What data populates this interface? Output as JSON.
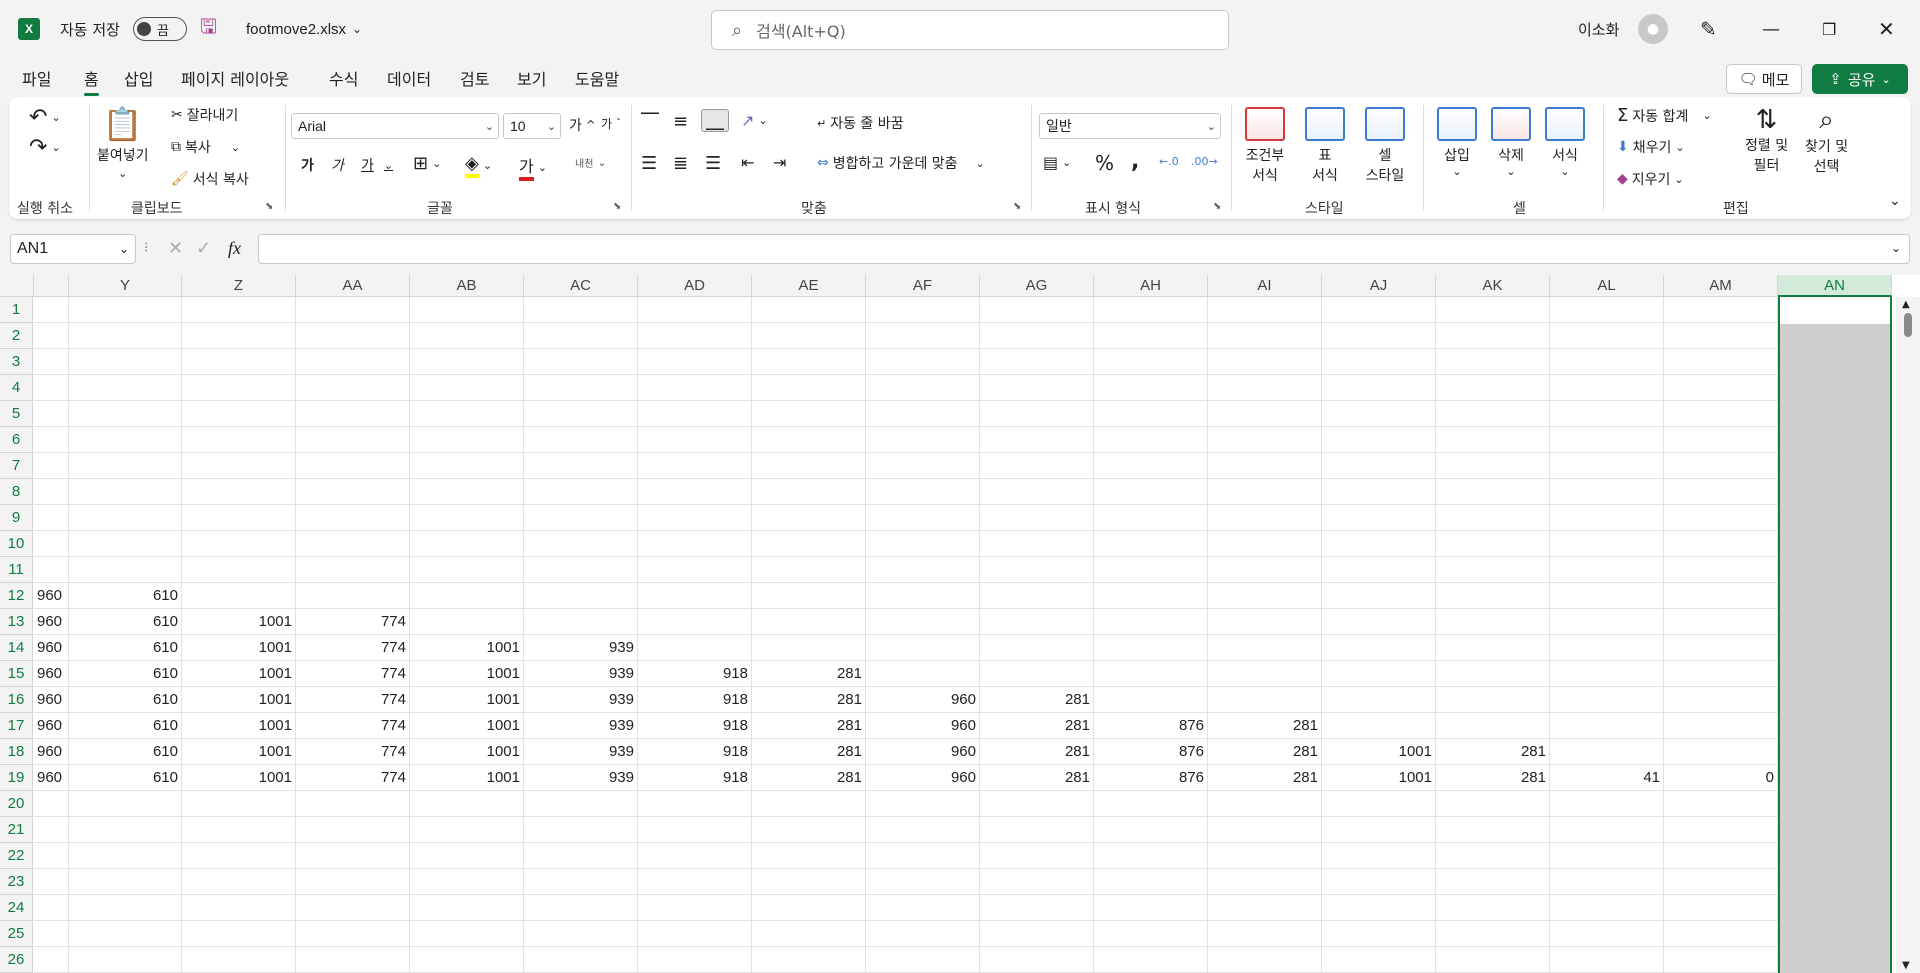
{
  "titlebar": {
    "autosave_label": "자동 저장",
    "autosave_state": "끔",
    "filename": "footmove2.xlsx",
    "search_placeholder": "검색(Alt+Q)",
    "user_name": "이소화"
  },
  "menu": {
    "items": [
      "파일",
      "홈",
      "삽입",
      "페이지 레이아웃",
      "수식",
      "데이터",
      "검토",
      "보기",
      "도움말"
    ],
    "active": "홈",
    "memo_label": "메모",
    "share_label": "공유"
  },
  "ribbon": {
    "undo_group": "실행 취소",
    "clipboard": {
      "label": "클립보드",
      "paste": "붙여넣기",
      "cut": "잘라내기",
      "copy": "복사",
      "format_painter": "서식 복사"
    },
    "font": {
      "label": "글꼴",
      "name": "Arial",
      "size": "10",
      "bold": "가",
      "italic": "가",
      "underline": "가",
      "font_color_letter": "가",
      "phonetic": "내천"
    },
    "alignment": {
      "label": "맞춤",
      "wrap": "자동 줄 바꿈",
      "merge": "병합하고 가운데 맞춤"
    },
    "number": {
      "label": "표시 형식",
      "format": "일반",
      "percent": "%",
      "comma": ","
    },
    "styles": {
      "label": "스타일",
      "conditional": [
        "조건부",
        "서식"
      ],
      "table": [
        "표",
        "서식"
      ],
      "cell": [
        "셀",
        "스타일"
      ]
    },
    "cells": {
      "label": "셀",
      "insert": "삽입",
      "delete": "삭제",
      "format": "서식"
    },
    "editing": {
      "label": "편집",
      "autosum": "자동 합계",
      "fill": "채우기",
      "clear": "지우기",
      "sort": [
        "정렬 및",
        "필터"
      ],
      "find": [
        "찾기 및",
        "선택"
      ]
    }
  },
  "formula_bar": {
    "name_box": "AN1",
    "fx": "fx",
    "content": ""
  },
  "sheet": {
    "columns": [
      "Y",
      "Z",
      "AA",
      "AB",
      "AC",
      "AD",
      "AE",
      "AF",
      "AG",
      "AH",
      "AI",
      "AJ",
      "AK",
      "AL",
      "AM",
      "AN"
    ],
    "selected_column": "AN",
    "rows": [
      {
        "n": "1",
        "c": []
      },
      {
        "n": "2",
        "c": []
      },
      {
        "n": "3",
        "c": []
      },
      {
        "n": "4",
        "c": []
      },
      {
        "n": "5",
        "c": []
      },
      {
        "n": "6",
        "c": []
      },
      {
        "n": "7",
        "c": []
      },
      {
        "n": "8",
        "c": []
      },
      {
        "n": "9",
        "c": []
      },
      {
        "n": "10",
        "c": []
      },
      {
        "n": "11",
        "c": []
      },
      {
        "n": "12",
        "c": [
          "960",
          "610"
        ]
      },
      {
        "n": "13",
        "c": [
          "960",
          "610",
          "1001",
          "774"
        ]
      },
      {
        "n": "14",
        "c": [
          "960",
          "610",
          "1001",
          "774",
          "1001",
          "939"
        ]
      },
      {
        "n": "15",
        "c": [
          "960",
          "610",
          "1001",
          "774",
          "1001",
          "939",
          "918",
          "281"
        ]
      },
      {
        "n": "16",
        "c": [
          "960",
          "610",
          "1001",
          "774",
          "1001",
          "939",
          "918",
          "281",
          "960",
          "281"
        ]
      },
      {
        "n": "17",
        "c": [
          "960",
          "610",
          "1001",
          "774",
          "1001",
          "939",
          "918",
          "281",
          "960",
          "281",
          "876",
          "281"
        ]
      },
      {
        "n": "18",
        "c": [
          "960",
          "610",
          "1001",
          "774",
          "1001",
          "939",
          "918",
          "281",
          "960",
          "281",
          "876",
          "281",
          "1001",
          "281"
        ]
      },
      {
        "n": "19",
        "c": [
          "960",
          "610",
          "1001",
          "774",
          "1001",
          "939",
          "918",
          "281",
          "960",
          "281",
          "876",
          "281",
          "1001",
          "281",
          "41",
          "0"
        ]
      },
      {
        "n": "20",
        "c": []
      },
      {
        "n": "21",
        "c": []
      },
      {
        "n": "22",
        "c": []
      },
      {
        "n": "23",
        "c": []
      },
      {
        "n": "24",
        "c": []
      },
      {
        "n": "25",
        "c": []
      },
      {
        "n": "26",
        "c": []
      }
    ]
  }
}
